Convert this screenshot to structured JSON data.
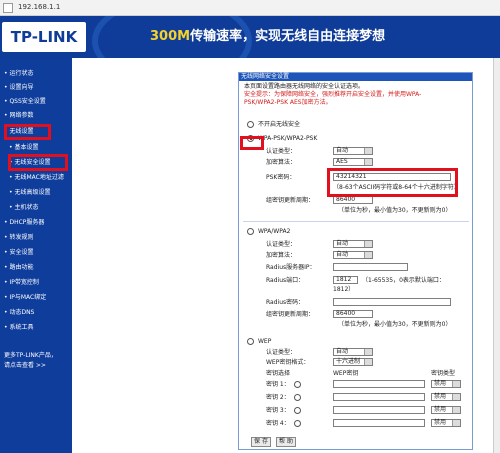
{
  "browser": {
    "url": "192.168.1.1"
  },
  "banner": {
    "logo": "TP-LINK",
    "slogan_prefix": "300M",
    "slogan_text": "传输速率，实现无线自由连接梦想"
  },
  "sidebar": {
    "items": [
      "运行状态",
      "设置向导",
      "QSS安全设置",
      "网络参数",
      "无线设置",
      "基本设置",
      "无线安全设置",
      "无线MAC地址过滤",
      "无线高级设置",
      "主机状态",
      "DHCP服务器",
      "转发规则",
      "安全设置",
      "路由功能",
      "IP带宽控制",
      "IP与MAC绑定",
      "动态DNS",
      "系统工具"
    ],
    "footer": [
      "更多TP-LINK产品，",
      "请点击查看 >>"
    ]
  },
  "panel": {
    "title": "无线网络安全设置",
    "intro": "本页面设置路由器无线网络的安全认证选项。",
    "warn1": "安全提示：为保障网络安全，强烈推荐开启安全设置，并使用WPA-",
    "warn2": "PSK/WPA2-PSK AES加密方法。",
    "opt_none": "不开启无线安全",
    "opt_psk": "WPA-PSK/WPA2-PSK",
    "psk": {
      "auth_label": "认证类型：",
      "auth_value": "自动",
      "enc_label": "加密算法：",
      "enc_value": "AES",
      "key_label": "PSK密码：",
      "key_value": "43214321",
      "key_hint": "（8-63个ASCII码字符或8-64个十六进制字符）",
      "period_label": "组密钥更新周期：",
      "period_value": "86400",
      "period_hint": "（单位为秒，最小值为30，不更新则为0）"
    },
    "opt_wpa": "WPA/WPA2",
    "wpa": {
      "auth_label": "认证类型：",
      "auth_value": "自动",
      "enc_label": "加密算法：",
      "enc_value": "自动",
      "server_label": "Radius服务器IP：",
      "server_value": "",
      "port_label": "Radius端口：",
      "port_value": "1812",
      "port_hint": "（1-65535，0表示默认端口：",
      "port_hint2": "1812）",
      "pass_label": "Radius密码：",
      "pass_value": "",
      "period_label": "组密钥更新周期：",
      "period_value": "86400",
      "period_hint": "（单位为秒，最小值为30，不更新则为0）"
    },
    "opt_wep": "WEP",
    "wep": {
      "auth_label": "认证类型：",
      "auth_value": "自动",
      "fmt_label": "WEP密钥格式：",
      "fmt_value": "十六进制",
      "col_sel": "密钥选择",
      "col_key": "WEP密钥",
      "col_type": "密钥类型",
      "keys": [
        {
          "label": "密钥 1：",
          "type": "禁用"
        },
        {
          "label": "密钥 2：",
          "type": "禁用"
        },
        {
          "label": "密钥 3：",
          "type": "禁用"
        },
        {
          "label": "密钥 4：",
          "type": "禁用"
        }
      ]
    },
    "save": "保 存",
    "help": "帮 助"
  }
}
